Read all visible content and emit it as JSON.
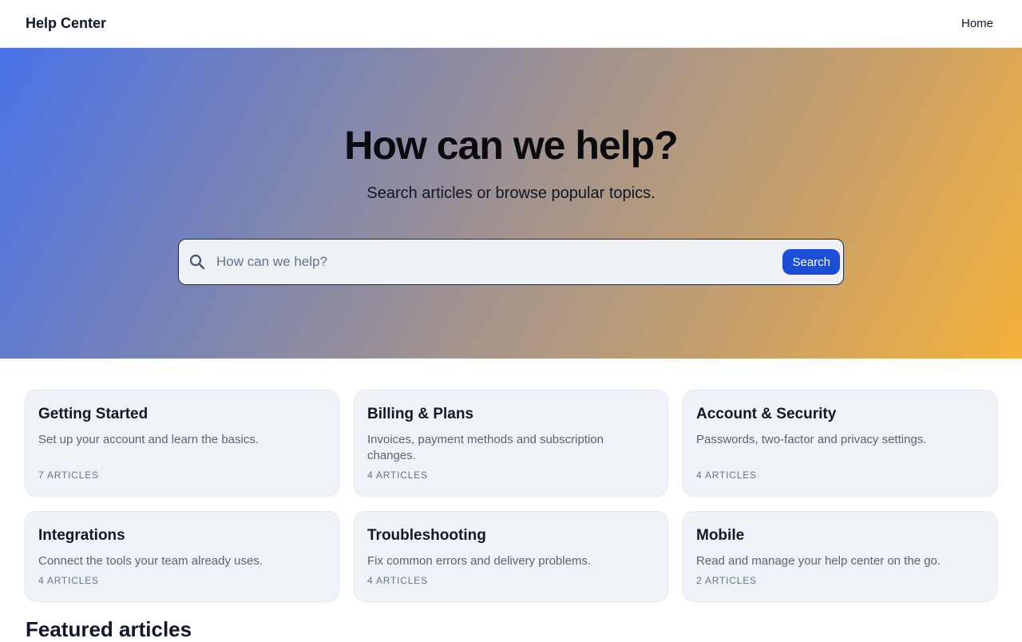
{
  "header": {
    "brand": "Help Center",
    "nav_home": "Home"
  },
  "hero": {
    "title": "How can we help?",
    "subtitle": "Search articles or browse popular topics.",
    "search": {
      "placeholder": "How can we help?",
      "value": "",
      "button_label": "Search"
    }
  },
  "categories": [
    {
      "title": "Getting Started",
      "description": "Set up your account and learn the basics.",
      "count": "7 ARTICLES"
    },
    {
      "title": "Billing & Plans",
      "description": "Invoices, payment methods and subscription changes.",
      "count": "4 ARTICLES"
    },
    {
      "title": "Account & Security",
      "description": "Passwords, two-factor and privacy settings.",
      "count": "4 ARTICLES"
    },
    {
      "title": "Integrations",
      "description": "Connect the tools your team already uses.",
      "count": "4 ARTICLES"
    },
    {
      "title": "Troubleshooting",
      "description": "Fix common errors and delivery problems.",
      "count": "4 ARTICLES"
    },
    {
      "title": "Mobile",
      "description": "Read and manage your help center on the go.",
      "count": "2 ARTICLES"
    }
  ],
  "featured": {
    "title": "Featured articles"
  },
  "colors": {
    "accent": "#1d4ed8",
    "card_bg": "#eff3f8",
    "gradient_start": "#4a73e8",
    "gradient_end": "#f5b23a"
  },
  "icons": {
    "search": "search-icon"
  }
}
